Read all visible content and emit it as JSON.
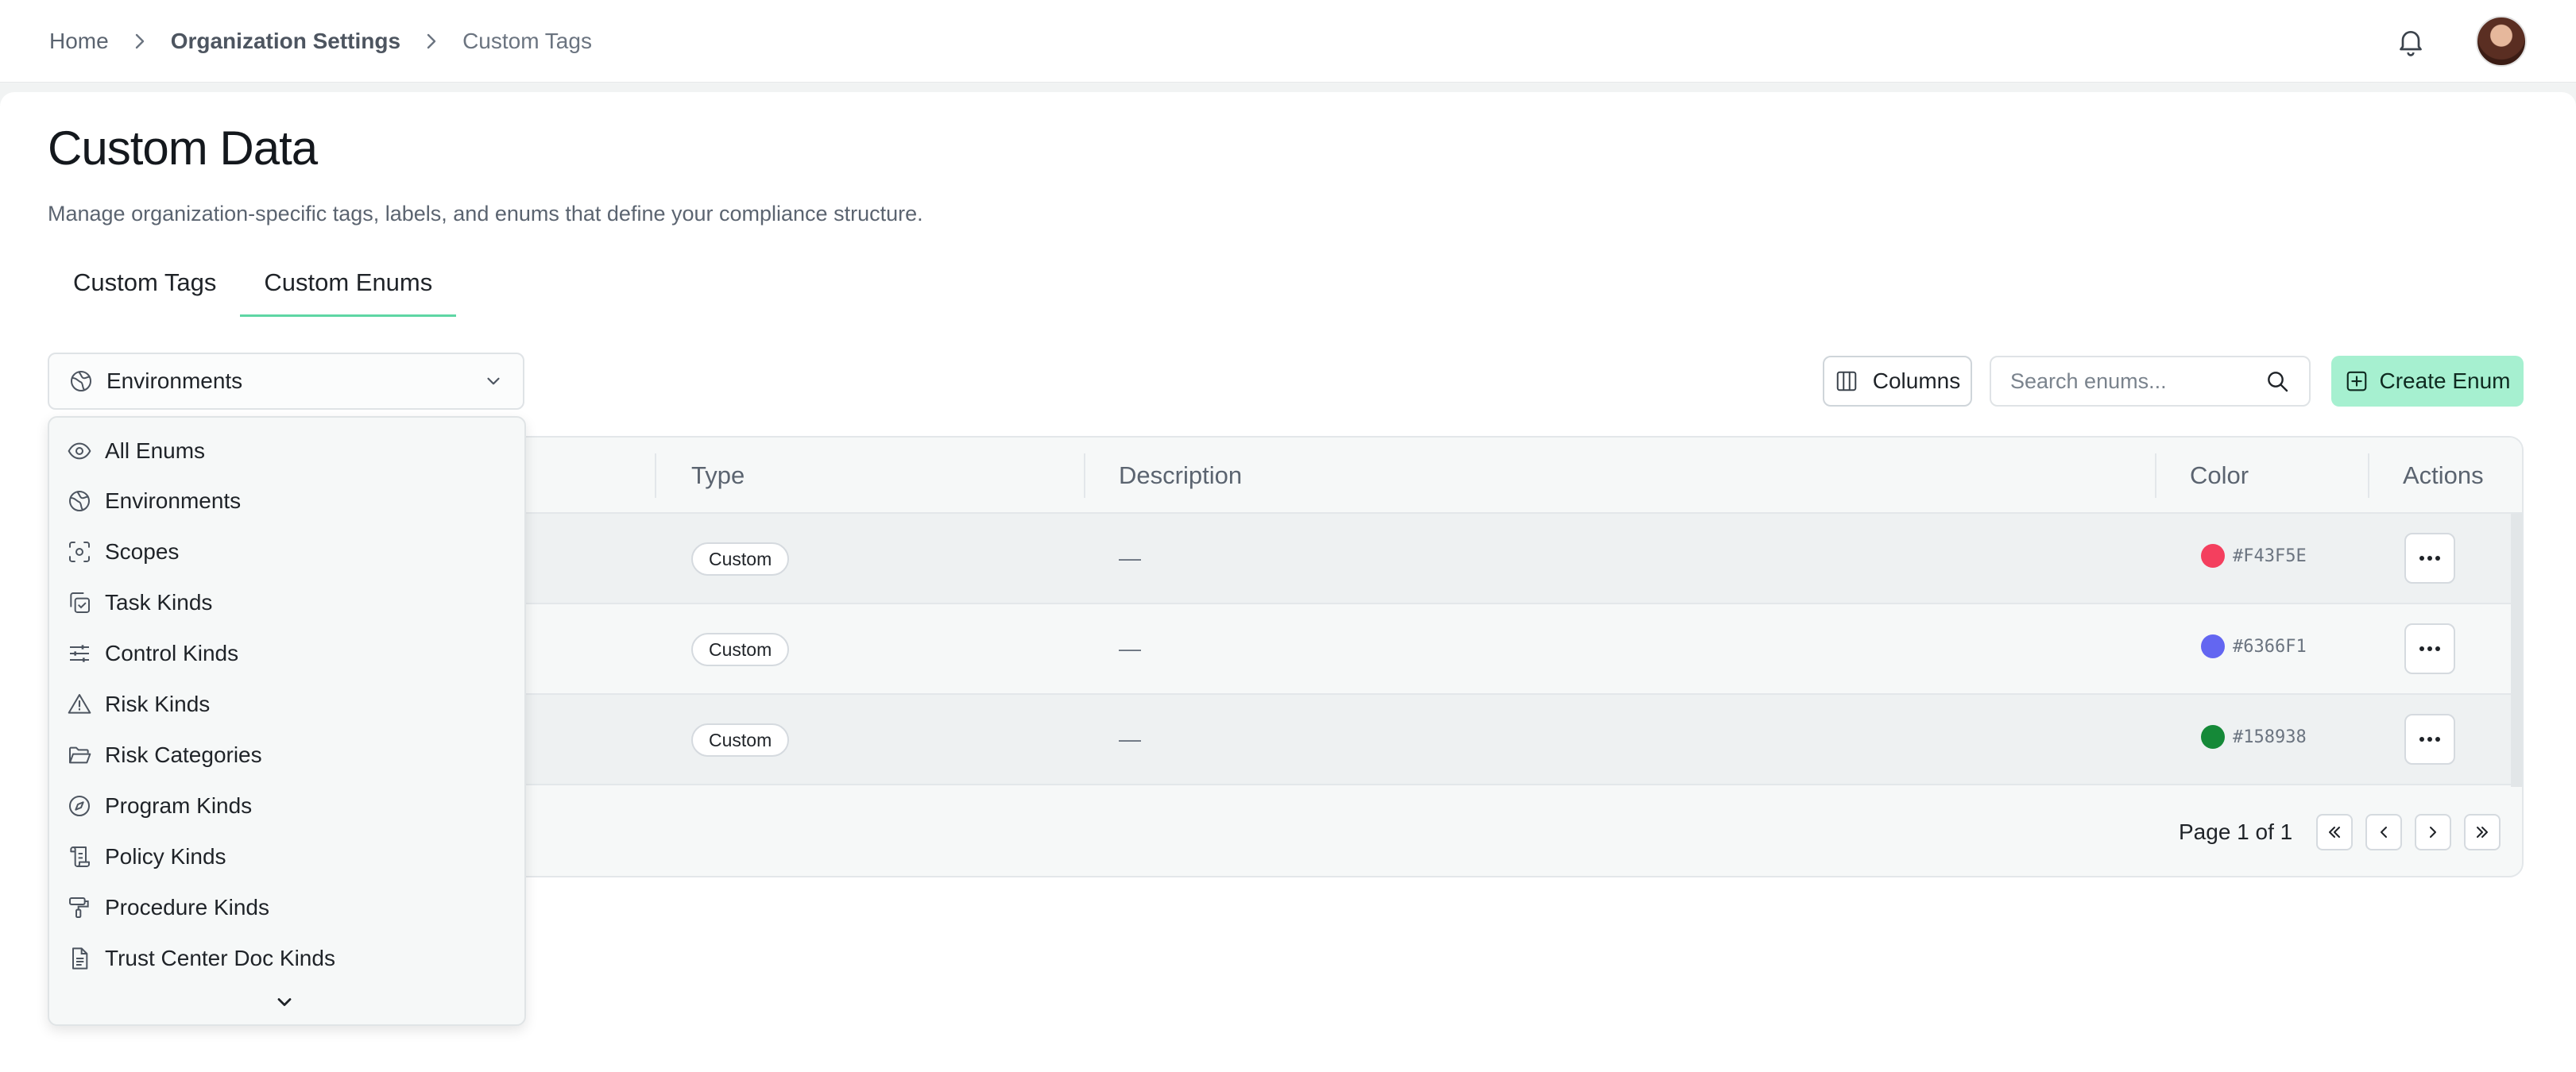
{
  "breadcrumb": {
    "home": "Home",
    "section": "Organization Settings",
    "current": "Custom Tags"
  },
  "header": {
    "bell_icon": "bell-icon",
    "avatar": "user-avatar"
  },
  "page": {
    "title": "Custom Data",
    "subtitle": "Manage organization-specific tags, labels, and enums that define your compliance structure."
  },
  "tabs": [
    {
      "label": "Custom Tags",
      "active": false
    },
    {
      "label": "Custom Enums",
      "active": true
    }
  ],
  "toolbar": {
    "selected_enum": "Environments",
    "columns_label": "Columns",
    "search_placeholder": "Search enums...",
    "create_label": "Create Enum"
  },
  "table": {
    "headers": [
      "Type",
      "Description",
      "Color",
      "Actions"
    ],
    "rows": [
      {
        "type": "Custom",
        "description": "—",
        "color": "#F43F5E"
      },
      {
        "type": "Custom",
        "description": "—",
        "color": "#6366F1"
      },
      {
        "type": "Custom",
        "description": "—",
        "color": "#158938"
      }
    ],
    "pagination": "Page 1 of 1"
  },
  "menu": {
    "items": [
      {
        "label": "All Enums",
        "icon": "eye-icon"
      },
      {
        "label": "Environments",
        "icon": "globe-icon"
      },
      {
        "label": "Scopes",
        "icon": "scan-icon"
      },
      {
        "label": "Task Kinds",
        "icon": "task-copy-check-icon"
      },
      {
        "label": "Control Kinds",
        "icon": "sliders-icon"
      },
      {
        "label": "Risk Kinds",
        "icon": "warning-triangle-icon"
      },
      {
        "label": "Risk Categories",
        "icon": "folder-open-icon"
      },
      {
        "label": "Program Kinds",
        "icon": "compass-icon"
      },
      {
        "label": "Policy Kinds",
        "icon": "scroll-icon"
      },
      {
        "label": "Procedure Kinds",
        "icon": "paint-roller-icon"
      },
      {
        "label": "Trust Center Doc Kinds",
        "icon": "file-text-icon"
      }
    ]
  },
  "colors": {
    "accent": "#5ED6A4",
    "create_button_bg": "#A6F0D0"
  }
}
